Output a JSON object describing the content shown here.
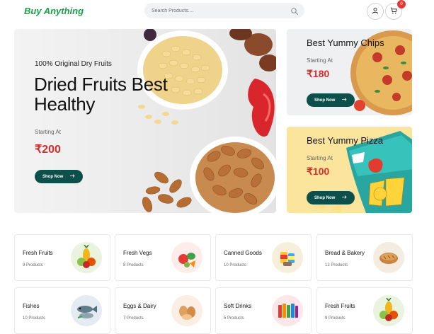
{
  "header": {
    "logo": "Buy Anything",
    "search_placeholder": "Search Products....",
    "cart_count": "0"
  },
  "hero": {
    "eyebrow": "100% Original Dry Fruits",
    "title_line1": "Dried Fruits Best",
    "title_line2": "Healthy",
    "starting_label": "Starting At",
    "price": "₹200",
    "button": "Shop Now"
  },
  "promo_chips": {
    "title": "Best Yummy Chips",
    "starting_label": "Starting At",
    "price": "₹180",
    "button": "Shop Now"
  },
  "promo_pizza": {
    "title": "Best Yummy Pizza",
    "starting_label": "Starting At",
    "price": "₹100",
    "button": "Shop Now"
  },
  "categories": [
    {
      "name": "Fresh Fruits",
      "count": "9 Products",
      "icon": "fruits-icon"
    },
    {
      "name": "Fresh Vegs",
      "count": "8 Products",
      "icon": "vegetables-icon"
    },
    {
      "name": "Canned Goods",
      "count": "10 Products",
      "icon": "canned-goods-icon"
    },
    {
      "name": "Bread & Bakery",
      "count": "12 Products",
      "icon": "bread-icon"
    },
    {
      "name": "Fishes",
      "count": "10 Products",
      "icon": "fish-icon"
    },
    {
      "name": "Eggs & Dairy",
      "count": "7 Products",
      "icon": "eggs-icon"
    },
    {
      "name": "Soft Drinks",
      "count": "5 Products",
      "icon": "soft-drinks-icon"
    },
    {
      "name": "Fresh Fruits",
      "count": "9 Products",
      "icon": "fruits-icon"
    }
  ],
  "colors": {
    "brand": "#17a34a",
    "button": "#0d4f4a",
    "price": "#d32f2f",
    "badge": "#e53935"
  }
}
